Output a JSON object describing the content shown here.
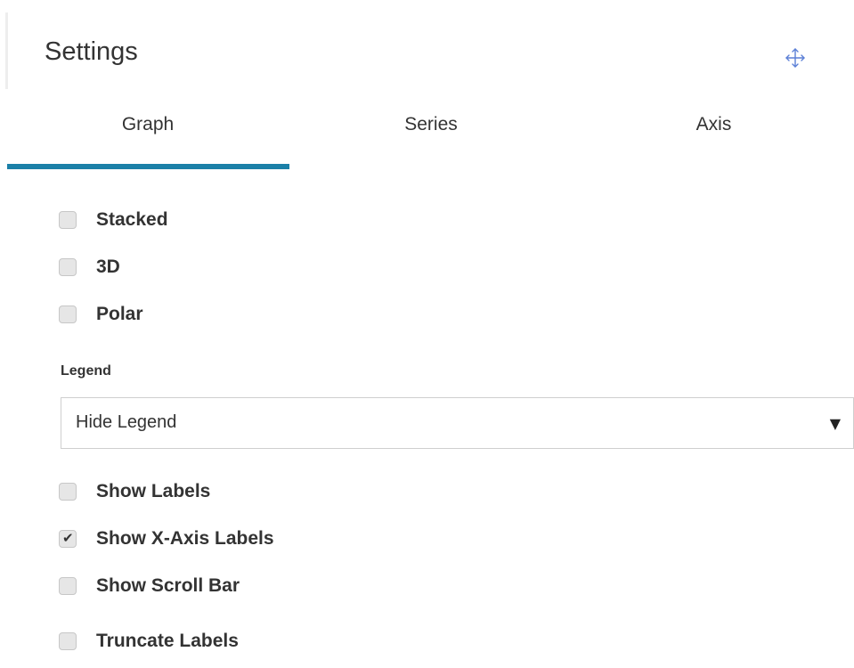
{
  "panel": {
    "title": "Settings",
    "move_icon": "move-arrows-icon",
    "accent_color": "#1b80a8"
  },
  "tabs": [
    {
      "label": "Graph",
      "active": true
    },
    {
      "label": "Series",
      "active": false
    },
    {
      "label": "Axis",
      "active": false
    }
  ],
  "graph_options": [
    {
      "label": "Stacked",
      "checked": false
    },
    {
      "label": "3D",
      "checked": false
    },
    {
      "label": "Polar",
      "checked": false
    }
  ],
  "legend": {
    "label": "Legend",
    "selected": "Hide Legend",
    "arrow_icon": "dropdown-arrow-icon"
  },
  "label_options": [
    {
      "label": "Show Labels",
      "checked": false
    },
    {
      "label": "Show X-Axis Labels",
      "checked": true
    },
    {
      "label": "Show Scroll Bar",
      "checked": false
    },
    {
      "label": "Truncate Labels",
      "checked": false
    }
  ]
}
